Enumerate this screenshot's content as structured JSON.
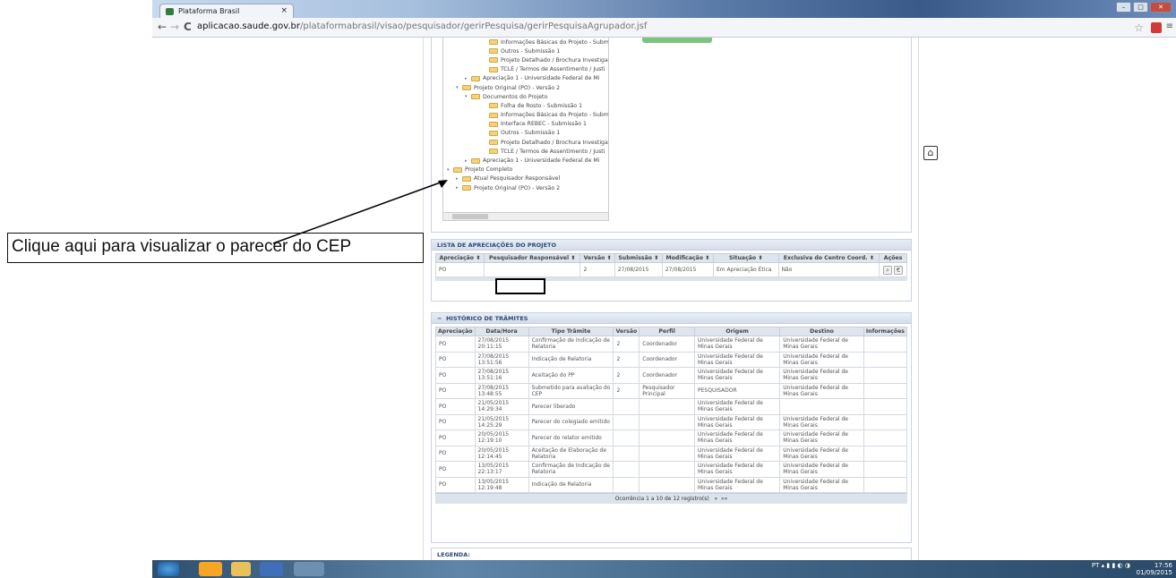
{
  "browser": {
    "tab_title": "Plataforma Brasil",
    "tab_close": "×",
    "back": "←",
    "forward": "→",
    "reload": "C",
    "url_host": "aplicacao.saude.gov.br",
    "url_path": "/plataformabrasil/visao/pesquisador/gerirPesquisa/gerirPesquisaAgrupador.jsf",
    "win_min": "–",
    "win_max": "□",
    "win_close": "✕",
    "star": "☆",
    "menu": "≡"
  },
  "tree": {
    "rows": [
      {
        "indent": 40,
        "toggle": "",
        "label": "Informações Básicas do Projeto - Subm"
      },
      {
        "indent": 40,
        "toggle": "",
        "label": "Outros - Submissão 1"
      },
      {
        "indent": 40,
        "toggle": "",
        "label": "Projeto Detalhado / Brochura Investigad"
      },
      {
        "indent": 40,
        "toggle": "",
        "label": "TCLE / Termos de Assentimento / Justi"
      },
      {
        "indent": 20,
        "toggle": "▸",
        "label": "Apreciação 1 - Universidade Federal de Mi"
      },
      {
        "indent": 10,
        "toggle": "▾",
        "label": "Projeto Original (PO) - Versão 2"
      },
      {
        "indent": 20,
        "toggle": "▾",
        "label": "Documentos do Projeto"
      },
      {
        "indent": 40,
        "toggle": "",
        "label": "Folha de Rosto - Submissão 1"
      },
      {
        "indent": 40,
        "toggle": "",
        "label": "Informações Básicas do Projeto - Subm"
      },
      {
        "indent": 40,
        "toggle": "",
        "label": "Interface REBEC - Submissão 1"
      },
      {
        "indent": 40,
        "toggle": "",
        "label": "Outros - Submissão 1"
      },
      {
        "indent": 40,
        "toggle": "",
        "label": "Projeto Detalhado / Brochura Investigad"
      },
      {
        "indent": 40,
        "toggle": "",
        "label": "TCLE / Termos de Assentimento / Justi"
      },
      {
        "indent": 20,
        "toggle": "▸",
        "label": "Apreciação 1 - Universidade Federal de Mi"
      },
      {
        "indent": 0,
        "toggle": "▾",
        "label": "Projeto Completo"
      },
      {
        "indent": 10,
        "toggle": "▸",
        "label": "Atual Pesquisador Responsável"
      },
      {
        "indent": 10,
        "toggle": "▸",
        "label": "Projeto Original (PO) - Versão 2"
      }
    ]
  },
  "apreciacoes": {
    "title": "LISTA DE APRECIAÇÕES DO PROJETO",
    "columns": [
      "Apreciação ⬍",
      "Pesquisador Responsável ⬍",
      "Versão ⬍",
      "Submissão ⬍",
      "Modificação ⬍",
      "Situação ⬍",
      "Exclusiva do Centro Coord. ⬍",
      "Ações"
    ],
    "rows": [
      [
        "PO",
        "",
        "2",
        "27/08/2015",
        "27/08/2015",
        "Em Apreciação Ética",
        "Não",
        ""
      ]
    ]
  },
  "historico": {
    "title": "HISTÓRICO DE TRÂMITES",
    "collapse": "−",
    "columns": [
      "Apreciação",
      "Data/Hora",
      "Tipo Trâmite",
      "Versão",
      "Perfil",
      "Origem",
      "Destino",
      "Informações"
    ],
    "rows": [
      [
        "PO",
        "27/08/2015 20:11:15",
        "Confirmação de Indicação de Relatoria",
        "2",
        "Coordenador",
        "Universidade Federal de Minas Gerais",
        "Universidade Federal de Minas Gerais",
        ""
      ],
      [
        "PO",
        "27/08/2015 13:51:56",
        "Indicação de Relatoria",
        "2",
        "Coordenador",
        "Universidade Federal de Minas Gerais",
        "Universidade Federal de Minas Gerais",
        ""
      ],
      [
        "PO",
        "27/08/2015 13:51:16",
        "Aceitação do PP",
        "2",
        "Coordenador",
        "Universidade Federal de Minas Gerais",
        "Universidade Federal de Minas Gerais",
        ""
      ],
      [
        "PO",
        "27/08/2015 13:48:55",
        "Submetido para avaliação do CEP",
        "2",
        "Pesquisador Principal",
        "PESQUISADOR",
        "Universidade Federal de Minas Gerais",
        ""
      ],
      [
        "PO",
        "21/05/2015 14:29:34",
        "Parecer liberado",
        "",
        "",
        "Universidade Federal de Minas Gerais",
        "",
        ""
      ],
      [
        "PO",
        "21/05/2015 14:25:29",
        "Parecer do colegiado emitido",
        "",
        "",
        "Universidade Federal de Minas Gerais",
        "Universidade Federal de Minas Gerais",
        ""
      ],
      [
        "PO",
        "20/05/2015 12:19:10",
        "Parecer do relator emitido",
        "",
        "",
        "Universidade Federal de Minas Gerais",
        "Universidade Federal de Minas Gerais",
        ""
      ],
      [
        "PO",
        "20/05/2015 12:14:45",
        "Aceitação de Elaboração de Relatoria",
        "",
        "",
        "Universidade Federal de Minas Gerais",
        "Universidade Federal de Minas Gerais",
        ""
      ],
      [
        "PO",
        "13/05/2015 22:13:17",
        "Confirmação de Indicação de Relatoria",
        "",
        "",
        "Universidade Federal de Minas Gerais",
        "Universidade Federal de Minas Gerais",
        ""
      ],
      [
        "PO",
        "13/05/2015 12:19:48",
        "Indicação de Relatoria",
        "",
        "",
        "Universidade Federal de Minas Gerais",
        "Universidade Federal de Minas Gerais",
        ""
      ]
    ],
    "pager": "Ocorrência 1 a 10 de 12 registro(s)",
    "next": "»",
    "last": "»»"
  },
  "legenda": "LEGENDA:",
  "callout": "Clique aqui para visualizar o parecer do CEP",
  "tray": {
    "lang": "PT",
    "time": "17:56",
    "date": "01/09/2015"
  }
}
